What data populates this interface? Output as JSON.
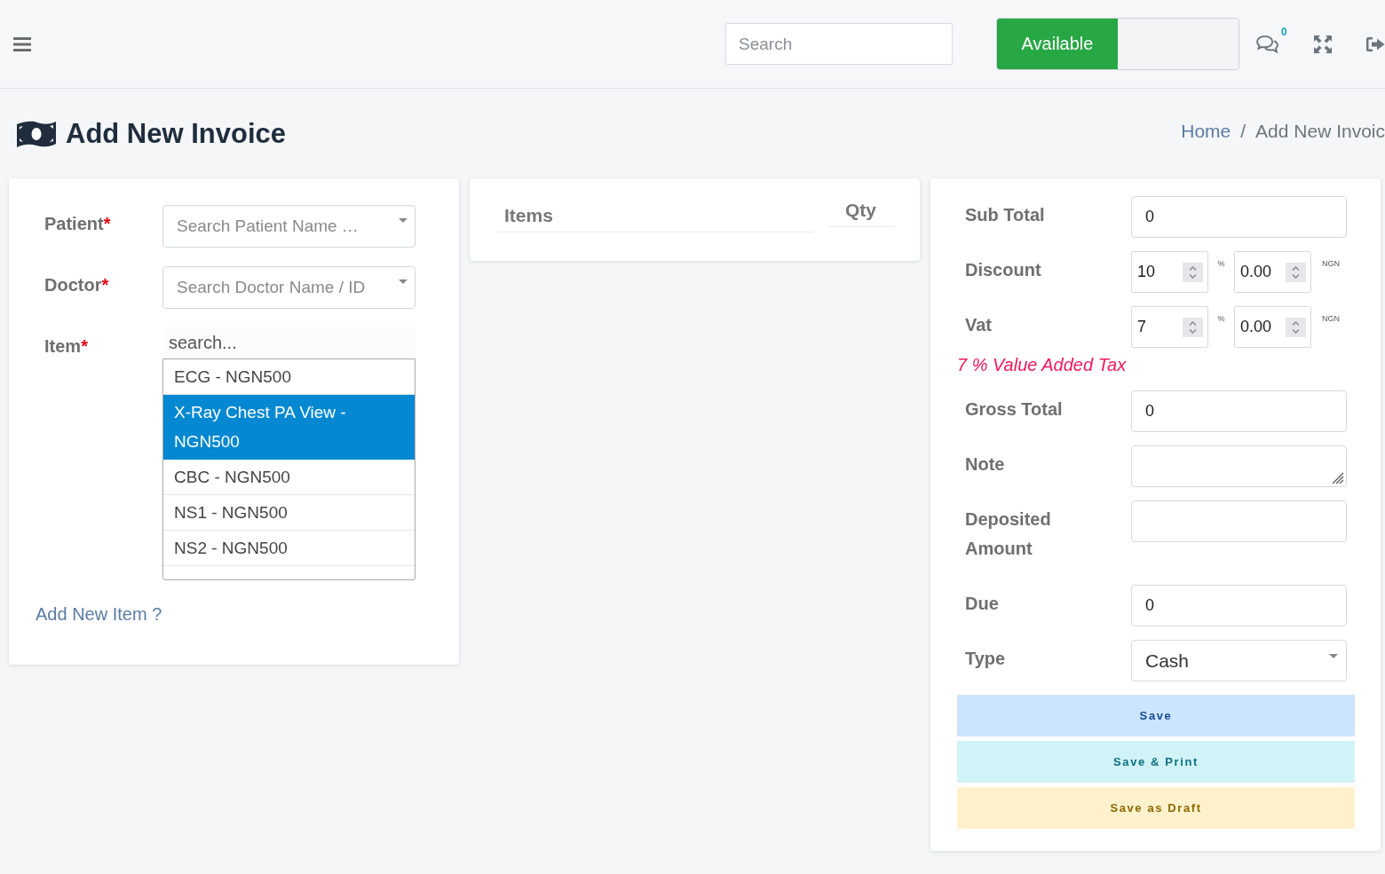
{
  "header": {
    "search": {
      "placeholder": "Search"
    },
    "status": {
      "label": "Available",
      "on": true
    },
    "notifications": {
      "count": "0"
    }
  },
  "page": {
    "title": "Add New Invoice",
    "breadcrumb": {
      "separator": "/",
      "items": [
        {
          "label": "Home",
          "kind": "link"
        },
        {
          "label": "Add New Invoic",
          "kind": "current"
        }
      ]
    }
  },
  "patient_form": {
    "fields": [
      {
        "kind": "select",
        "label": "Patient",
        "required_mark": "*",
        "placeholder": "Search Patient Name …"
      },
      {
        "kind": "select",
        "label": "Doctor",
        "required_mark": "*",
        "placeholder": "Search Doctor Name / ID"
      },
      {
        "kind": "picker",
        "label": "Item",
        "required_mark": "*",
        "search": {
          "placeholder": "search..."
        },
        "options": [
          {
            "label": "ECG - NGN500",
            "selected": false
          },
          {
            "label": "X-Ray Chest PA View - NGN500",
            "selected": true
          },
          {
            "label": "CBC - NGN500",
            "selected": false
          },
          {
            "label": "NS1 - NGN500",
            "selected": false
          },
          {
            "label": "NS2 - NGN500",
            "selected": false
          }
        ]
      }
    ],
    "add_item_link": "Add New Item ?"
  },
  "items_table": {
    "columns": [
      {
        "label": "Items",
        "kind": "name"
      },
      {
        "label": "Qty",
        "kind": "qty"
      }
    ]
  },
  "summary": {
    "rows": [
      {
        "kind": "input",
        "label": "Sub Total",
        "value": "0"
      },
      {
        "kind": "pair",
        "label": "Discount",
        "percent": {
          "value": "10",
          "unit": "%"
        },
        "amount": {
          "value": "0.00",
          "unit": "NGN"
        }
      },
      {
        "kind": "pair",
        "label": "Vat",
        "percent": {
          "value": "7",
          "unit": "%"
        },
        "amount": {
          "value": "0.00",
          "unit": "NGN"
        }
      },
      {
        "kind": "note",
        "text": "7 % Value Added Tax"
      },
      {
        "kind": "input",
        "label": "Gross Total",
        "value": "0"
      },
      {
        "kind": "textarea",
        "label": "Note"
      },
      {
        "kind": "input",
        "label": "Deposited Amount"
      },
      {
        "kind": "input",
        "label": "Due",
        "value": "0"
      },
      {
        "kind": "select",
        "label": "Type",
        "value": "Cash"
      }
    ],
    "buttons": [
      {
        "label": "Save",
        "kind": "save"
      },
      {
        "label": "Save & Print",
        "kind": "save_print"
      },
      {
        "label": "Save as Draft",
        "kind": "draft"
      }
    ]
  }
}
